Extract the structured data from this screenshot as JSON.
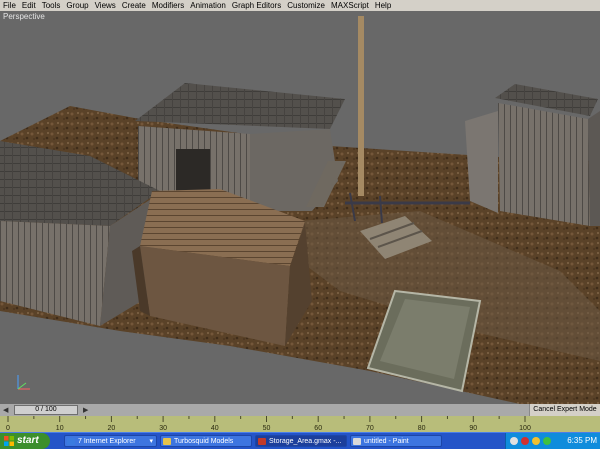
{
  "menu": [
    "File",
    "Edit",
    "Tools",
    "Group",
    "Views",
    "Create",
    "Modifiers",
    "Animation",
    "Graph Editors",
    "Customize",
    "MAXScript",
    "Help"
  ],
  "viewport": {
    "label": "Perspective"
  },
  "timeline": {
    "frame": "0 / 100",
    "cancel_label": "Cancel Expert Mode"
  },
  "ruler": {
    "ticks": [
      "0",
      "10",
      "20",
      "30",
      "40",
      "50",
      "60",
      "70",
      "80",
      "90",
      "100"
    ]
  },
  "taskbar": {
    "start": "start",
    "buttons": [
      {
        "label": "7 Internet Explorer",
        "count": "▾",
        "color": "#3a7be0"
      },
      {
        "label": "Turbosquid Models",
        "color": "#e6c34a"
      },
      {
        "label": "Storage_Area.gmax -...",
        "color": "#c23a2a"
      },
      {
        "label": "untitled - Paint",
        "color": "#d9d9d9"
      }
    ],
    "clock": "6:35 PM"
  }
}
